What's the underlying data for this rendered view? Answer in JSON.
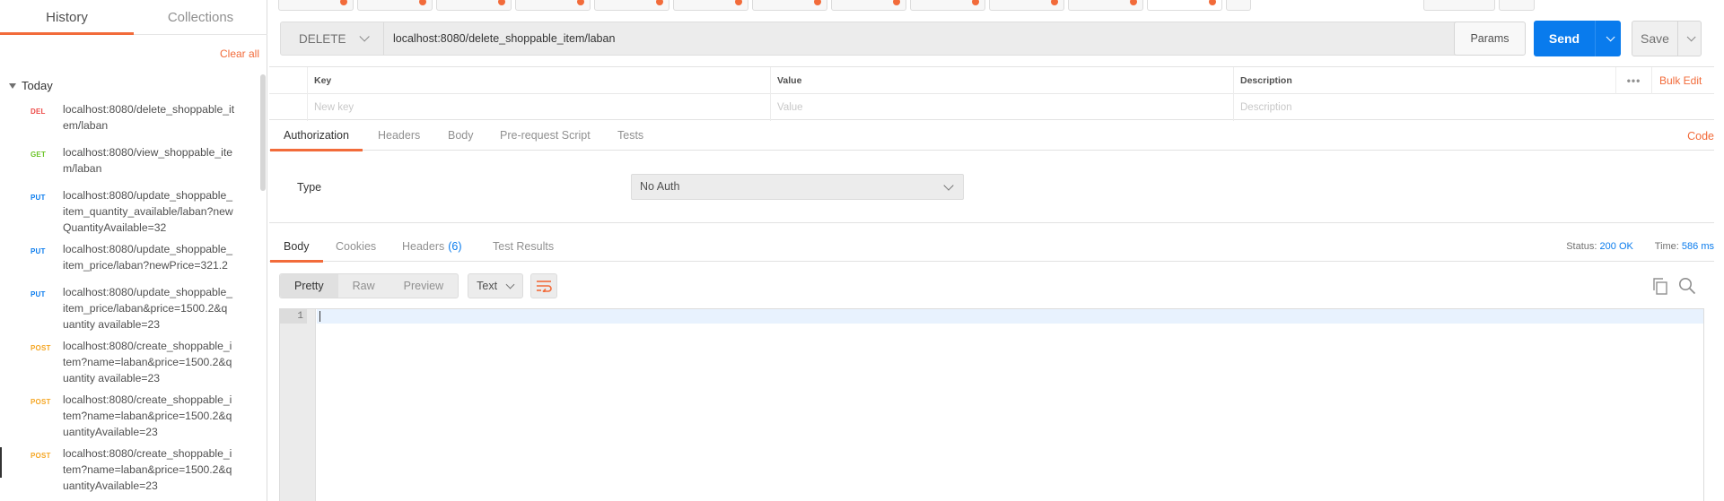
{
  "sidebar": {
    "tabs": [
      {
        "label": "History",
        "active": true
      },
      {
        "label": "Collections",
        "active": false
      }
    ],
    "clear_all": "Clear all",
    "group_label": "Today",
    "history": [
      {
        "method": "DEL",
        "color": "#ed4b48",
        "url": "localhost:8080/delete_shoppable_it\nem/laban"
      },
      {
        "method": "GET",
        "color": "#6bc427",
        "url": "localhost:8080/view_shoppable_ite\nm/laban"
      },
      {
        "method": "PUT",
        "color": "#097bed",
        "url": "localhost:8080/update_shoppable_\nitem_quantity_available/laban?new\nQuantityAvailable=32"
      },
      {
        "method": "PUT",
        "color": "#097bed",
        "url": "localhost:8080/update_shoppable_\nitem_price/laban?newPrice=321.2"
      },
      {
        "method": "PUT",
        "color": "#097bed",
        "url": "localhost:8080/update_shoppable_\nitem_price/laban&price=1500.2&q\nuantity available=23"
      },
      {
        "method": "POST",
        "color": "#f5a623",
        "url": "localhost:8080/create_shoppable_i\ntem?name=laban&price=1500.2&q\nuantity available=23"
      },
      {
        "method": "POST",
        "color": "#f5a623",
        "url": "localhost:8080/create_shoppable_i\ntem?name=laban&price=1500.2&q\nuantityAvailable=23"
      },
      {
        "method": "POST",
        "color": "#f5a623",
        "url": "localhost:8080/create_shoppable_i\ntem?name=laban&price=1500.2&q\nuantityAvailable=23"
      }
    ]
  },
  "request": {
    "method": "DELETE",
    "url": "localhost:8080/delete_shoppable_item/laban",
    "params_label": "Params",
    "send_label": "Send",
    "save_label": "Save"
  },
  "params_table": {
    "headers": {
      "key": "Key",
      "value": "Value",
      "description": "Description"
    },
    "more": "•••",
    "bulk_edit": "Bulk Edit",
    "placeholders": {
      "key": "New key",
      "value": "Value",
      "description": "Description"
    }
  },
  "request_tabs": {
    "tabs": [
      "Authorization",
      "Headers",
      "Body",
      "Pre-request Script",
      "Tests"
    ],
    "active": "Authorization",
    "code_link": "Code"
  },
  "auth": {
    "type_label": "Type",
    "type_value": "No Auth"
  },
  "response": {
    "tabs": {
      "body": "Body",
      "cookies": "Cookies",
      "headers": "Headers",
      "headers_count": "(6)",
      "tests": "Test Results"
    },
    "status_label": "Status:",
    "status_value": "200 OK",
    "time_label": "Time:",
    "time_value": "586 ms",
    "views": [
      "Pretty",
      "Raw",
      "Preview"
    ],
    "active_view": "Pretty",
    "language": "Text",
    "line_number": "1"
  },
  "colors": {
    "accent": "#f26b3a",
    "primary": "#097bed"
  }
}
